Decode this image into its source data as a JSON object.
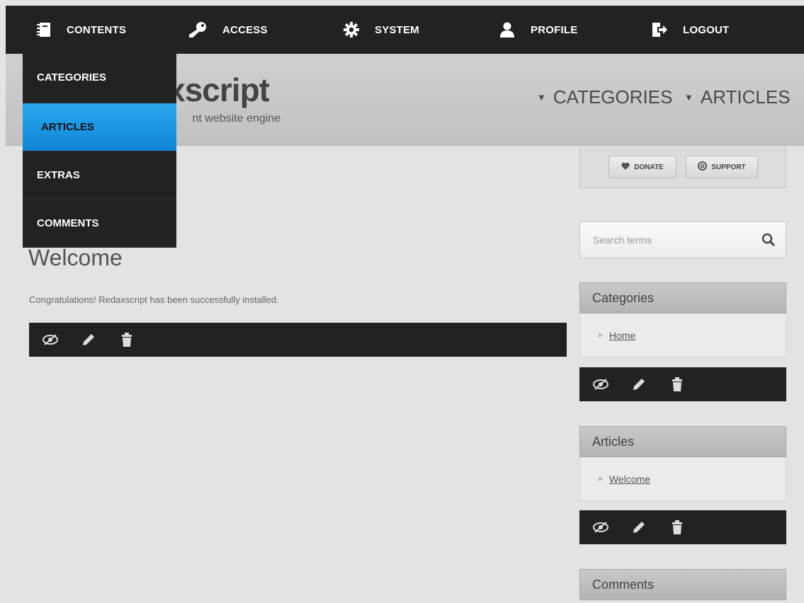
{
  "adminbar": {
    "items": [
      {
        "label": "CONTENTS",
        "icon": "book-icon"
      },
      {
        "label": "ACCESS",
        "icon": "key-icon"
      },
      {
        "label": "SYSTEM",
        "icon": "gear-icon"
      },
      {
        "label": "PROFILE",
        "icon": "user-icon"
      },
      {
        "label": "LOGOUT",
        "icon": "logout-icon"
      }
    ]
  },
  "dropdown": {
    "items": [
      "CATEGORIES",
      "ARTICLES",
      "EXTRAS",
      "COMMENTS"
    ],
    "active": "ARTICLES"
  },
  "header": {
    "title_visible": "xscript",
    "slogan_visible": "nt website engine",
    "nav": [
      {
        "label": "CATEGORIES"
      },
      {
        "label": "ARTICLES"
      }
    ]
  },
  "main": {
    "title": "Welcome",
    "text": "Congratulations! Redaxscript has been successfully installed."
  },
  "sidebar": {
    "donate_label": "DONATE",
    "support_label": "SUPPORT",
    "search_placeholder": "Search terms",
    "boxes": [
      {
        "title": "Categories",
        "link": "Home"
      },
      {
        "title": "Articles",
        "link": "Welcome"
      },
      {
        "title": "Comments"
      }
    ]
  },
  "colors": {
    "bar": "#222222",
    "active": "#1a97e4",
    "background": "#e3e3e3"
  }
}
